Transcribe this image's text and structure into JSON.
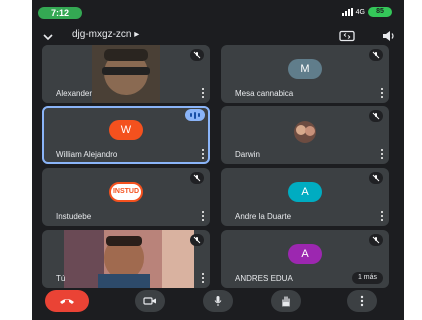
{
  "status_bar": {
    "time": "7:12",
    "network": "4G",
    "battery": "85"
  },
  "header": {
    "meeting_code": "djg-mxgz-zcn ▸"
  },
  "participants": [
    {
      "name": "Alexander"
    },
    {
      "name": "Mesa cannabica",
      "initial": "M",
      "avatar_color": "#607d8b"
    },
    {
      "name": "William Alejandro",
      "initial": "W",
      "avatar_color": "#f4511e"
    },
    {
      "name": "Darwin"
    },
    {
      "name": "Instudebe",
      "initial": "INSTUD"
    },
    {
      "name": "Andre la Duarte",
      "initial": "A",
      "avatar_color": "#00acc1"
    },
    {
      "name": "Tú"
    },
    {
      "name": "ANDRES EDUA",
      "initial": "A",
      "avatar_color": "#9c27b0",
      "extra": "1 más"
    }
  ],
  "icons": {
    "back": "chevron-down-icon",
    "camera_switch": "camera-switch-icon",
    "speaker": "speaker-icon",
    "mic_off": "mic-off-icon",
    "end_call": "end-call-icon",
    "camera": "camera-icon",
    "mic": "mic-icon",
    "raise_hand": "raise-hand-icon",
    "more": "more-vert-icon"
  },
  "colors": {
    "end_call": "#ea4335",
    "active_speaker": "#8ab4f8",
    "background": "#1c1d20"
  }
}
